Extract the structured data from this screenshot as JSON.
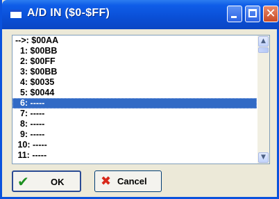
{
  "window": {
    "title": "A/D IN ($0-$FF)",
    "close_glyph": "✕"
  },
  "list": {
    "items": [
      "-->: $00AA",
      "  1: $00BB",
      "  2: $00FF",
      "  3: $00BB",
      "  4: $0035",
      "  5: $0044",
      "  6: -----",
      "  7: -----",
      "  8: -----",
      "  9: -----",
      " 10: -----",
      " 11: -----"
    ],
    "selected_index": 6
  },
  "scrollbar": {
    "up_arrow": "▲",
    "down_arrow": "▼"
  },
  "buttons": {
    "ok_icon": "✔",
    "ok_label": "OK",
    "cancel_icon": "✖",
    "cancel_label": "Cancel"
  }
}
